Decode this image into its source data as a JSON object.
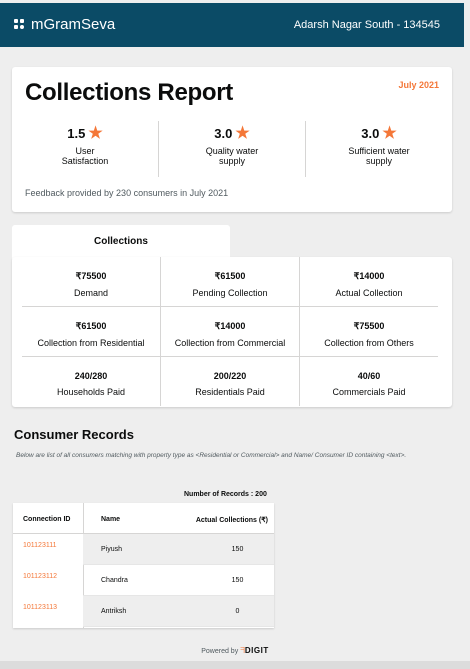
{
  "header": {
    "app_name": "mGramSeva",
    "location": "Adarsh Nagar South - 134545",
    "logo_icon": "dots-logo-icon"
  },
  "report": {
    "title": "Collections Report",
    "month": "July 2021",
    "ratings": [
      {
        "value": "1.5",
        "label_line1": "User",
        "label_line2": "Satisfaction"
      },
      {
        "value": "3.0",
        "label_line1": "Quality water",
        "label_line2": "supply"
      },
      {
        "value": "3.0",
        "label_line1": "Sufficient water",
        "label_line2": "supply"
      }
    ],
    "star_icon": "star-icon",
    "star_color": "#f47738",
    "feedback": "Feedback provided by 230 consumers in July 2021"
  },
  "collections": {
    "tab_label": "Collections",
    "rows": [
      [
        {
          "amount": "₹75500",
          "label": "Demand"
        },
        {
          "amount": "₹61500",
          "label": "Pending Collection"
        },
        {
          "amount": "₹14000",
          "label": "Actual Collection"
        }
      ],
      [
        {
          "amount": "₹61500",
          "label": "Collection from Residential"
        },
        {
          "amount": "₹14000",
          "label": "Collection from Commercial"
        },
        {
          "amount": "₹75500",
          "label": "Collection from Others"
        }
      ],
      [
        {
          "amount": "240/280",
          "label": "Households Paid"
        },
        {
          "amount": "200/220",
          "label": "Residentials Paid"
        },
        {
          "amount": "40/60",
          "label": "Commercials Paid"
        }
      ]
    ]
  },
  "consumer_records": {
    "title": "Consumer Records",
    "note": "Below are list of all consumers matching with property type as <Residential or Commercial> and Name/ Consumer ID containing <text>.",
    "count_label": "Number of Records : 200",
    "columns": {
      "connection_id": "Connection ID",
      "name": "Name",
      "actual": "Actual Collections (₹)"
    },
    "rows": [
      {
        "connection_id": "101123111",
        "name": "Piyush",
        "actual": "150"
      },
      {
        "connection_id": "101123112",
        "name": "Chandra",
        "actual": "150"
      },
      {
        "connection_id": "101123113",
        "name": "Antriksh",
        "actual": "0"
      }
    ]
  },
  "footer": {
    "powered_by": "Powered by",
    "brand": "DIGIT",
    "brand_icon": "digit-logo-icon"
  },
  "colors": {
    "header_bg": "#0b4b66",
    "accent": "#f47738"
  }
}
